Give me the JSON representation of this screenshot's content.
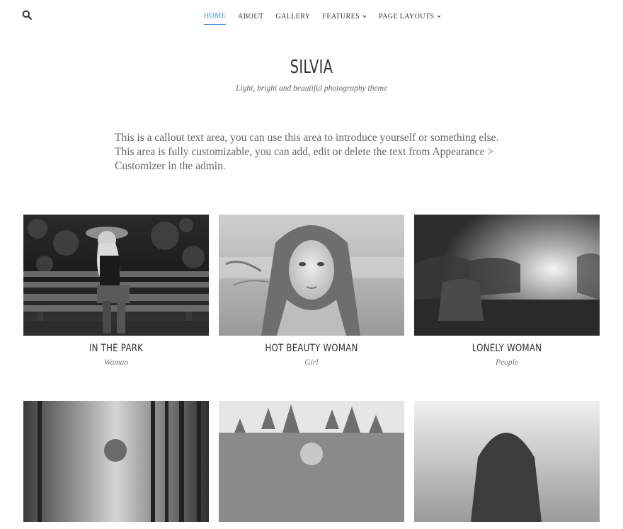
{
  "header": {
    "search_icon": "search-icon",
    "nav": [
      {
        "label": "HOME",
        "active": true,
        "dropdown": false
      },
      {
        "label": "ABOUT",
        "active": false,
        "dropdown": false
      },
      {
        "label": "GALLERY",
        "active": false,
        "dropdown": false
      },
      {
        "label": "FEATURES",
        "active": false,
        "dropdown": true
      },
      {
        "label": "PAGE LAYOUTS",
        "active": false,
        "dropdown": true
      }
    ],
    "accent_color": "#3a8fd6"
  },
  "site": {
    "title": "SILVIA",
    "tagline": "Light, bright and beautiful photography theme"
  },
  "callout": {
    "text": "This is a callout text area, you can use this area to introduce yourself or something else. This area is fully customizable, you can add, edit or delete the text from Appearance > Customizer in the admin."
  },
  "gallery": {
    "items": [
      {
        "title": "IN THE PARK",
        "category": "Woman"
      },
      {
        "title": "HOT BEAUTY WOMAN",
        "category": "Girl"
      },
      {
        "title": "LONELY WOMAN",
        "category": "People"
      },
      {
        "title": "",
        "category": ""
      },
      {
        "title": "",
        "category": ""
      },
      {
        "title": "",
        "category": ""
      }
    ]
  }
}
